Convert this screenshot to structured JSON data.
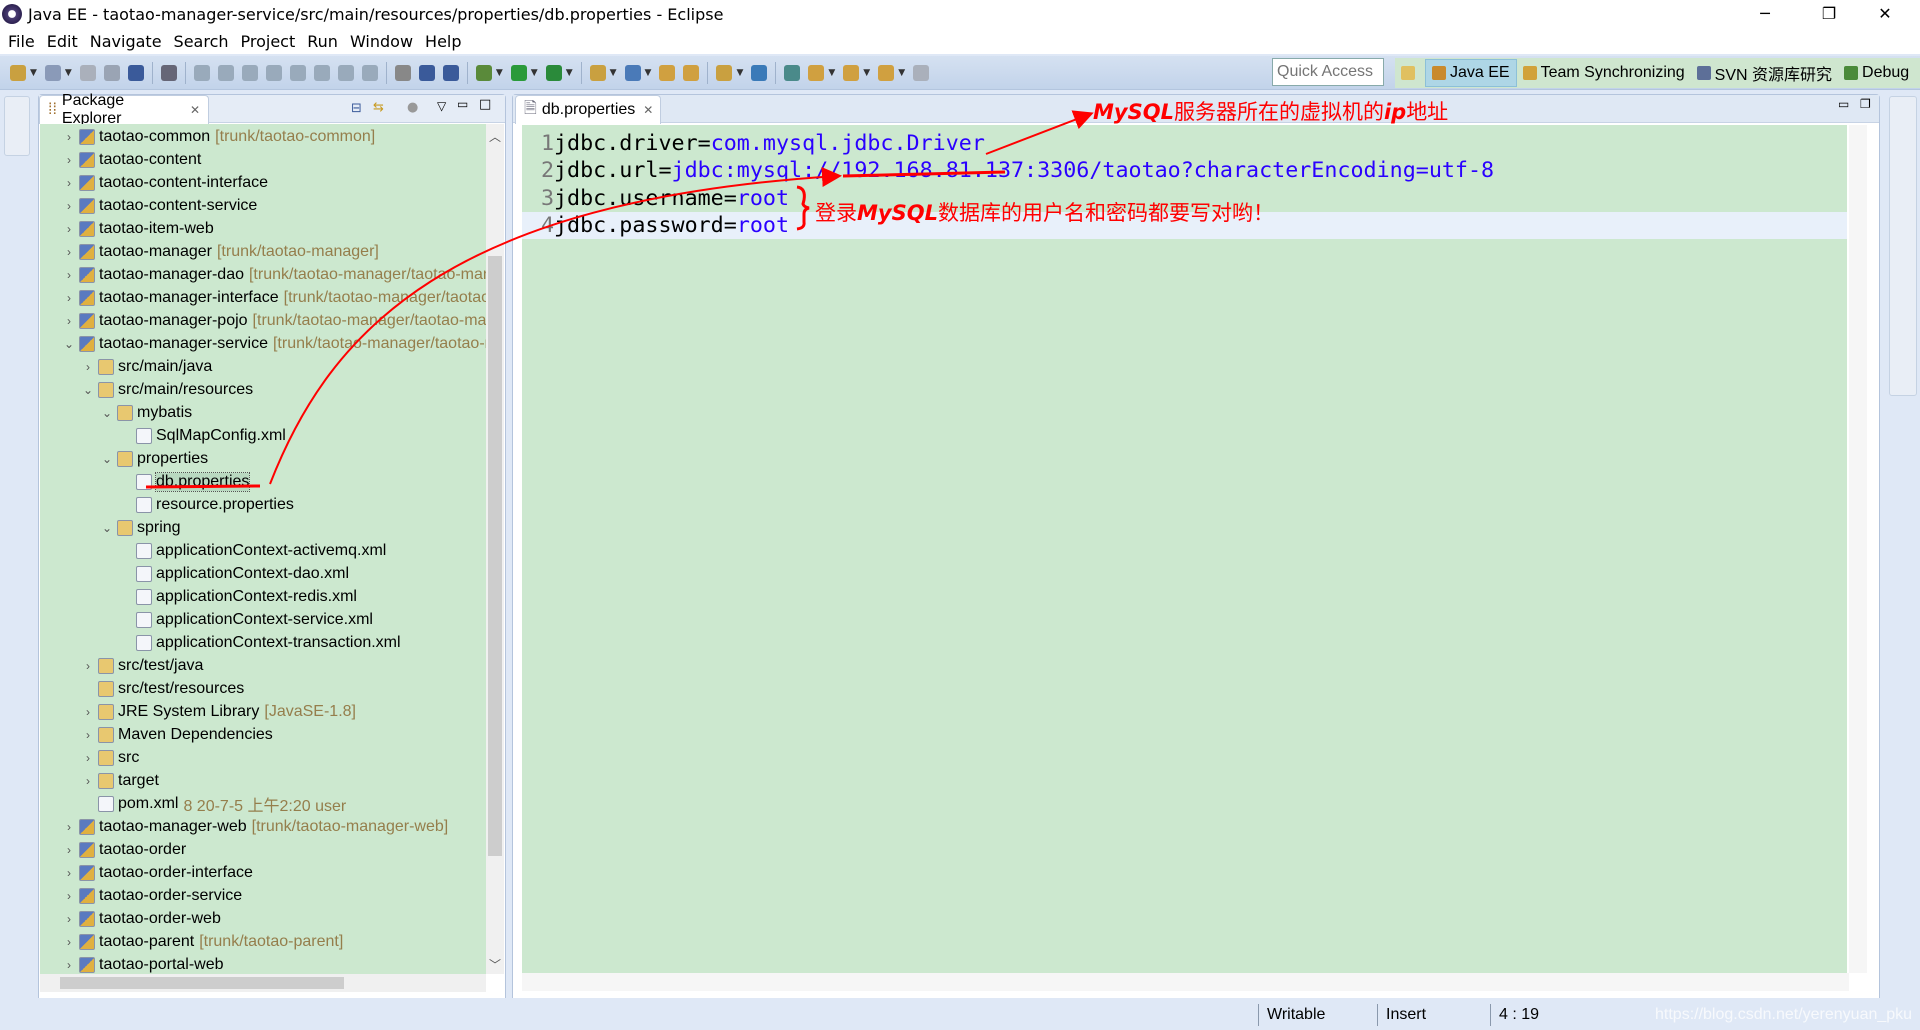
{
  "window": {
    "title": "Java EE - taotao-manager-service/src/main/resources/properties/db.properties - Eclipse",
    "minimize": "─",
    "restore": "❐",
    "close": "✕"
  },
  "menu": [
    "File",
    "Edit",
    "Navigate",
    "Search",
    "Project",
    "Run",
    "Window",
    "Help"
  ],
  "toolbar": {
    "icons": [
      "new-icon",
      "new-dropdown-icon",
      "save-icon",
      "save-all-icon",
      "terminal-icon",
      "skip-breakpoints-icon",
      "resume-icon",
      "suspend-icon",
      "terminate-icon",
      "disconnect-icon",
      "step-into-icon",
      "step-over-icon",
      "step-return-icon",
      "drop-to-frame-icon",
      "use-step-filters-icon",
      "toggle-block-icon",
      "show-whitespace-icon",
      "debug-icon",
      "run-icon",
      "run-server-icon",
      "new-server-icon",
      "new-class-icon",
      "open-type-icon",
      "open-task-icon",
      "search-icon",
      "globe-icon",
      "sync-icon",
      "next-annotation-icon",
      "prev-annotation-icon",
      "back-icon",
      "forward-icon"
    ],
    "quick_access_placeholder": "Quick Access"
  },
  "perspectives": [
    {
      "label": "Java EE",
      "selected": true,
      "color": "#c98a2d"
    },
    {
      "label": "Team Synchronizing",
      "selected": false,
      "color": "#d1a23a"
    },
    {
      "label": "SVN 资源库研究",
      "selected": false,
      "color": "#5d6f98"
    },
    {
      "label": "Debug",
      "selected": false,
      "color": "#4a8a3a"
    }
  ],
  "package_explorer": {
    "tab_label": "Package Explorer",
    "items": [
      {
        "level": 0,
        "arrow": "›",
        "label": "taotao-common",
        "deco": "[trunk/taotao-common]"
      },
      {
        "level": 0,
        "arrow": "›",
        "label": "taotao-content",
        "deco": ""
      },
      {
        "level": 0,
        "arrow": "›",
        "label": "taotao-content-interface",
        "deco": ""
      },
      {
        "level": 0,
        "arrow": "›",
        "label": "taotao-content-service",
        "deco": ""
      },
      {
        "level": 0,
        "arrow": "›",
        "label": "taotao-item-web",
        "deco": ""
      },
      {
        "level": 0,
        "arrow": "›",
        "label": "taotao-manager",
        "deco": "[trunk/taotao-manager]"
      },
      {
        "level": 0,
        "arrow": "›",
        "label": "taotao-manager-dao",
        "deco": "[trunk/taotao-manager/taotao-manager-dao]"
      },
      {
        "level": 0,
        "arrow": "›",
        "label": "taotao-manager-interface",
        "deco": "[trunk/taotao-manager/taotao-manager-interface]"
      },
      {
        "level": 0,
        "arrow": "›",
        "label": "taotao-manager-pojo",
        "deco": "[trunk/taotao-manager/taotao-manager-pojo]"
      },
      {
        "level": 0,
        "arrow": "⌄",
        "label": "taotao-manager-service",
        "deco": "[trunk/taotao-manager/taotao-manager-service]"
      },
      {
        "level": 1,
        "arrow": "›",
        "label": "src/main/java",
        "deco": ""
      },
      {
        "level": 1,
        "arrow": "⌄",
        "label": "src/main/resources",
        "deco": ""
      },
      {
        "level": 2,
        "arrow": "⌄",
        "label": "mybatis",
        "deco": ""
      },
      {
        "level": 3,
        "arrow": "",
        "label": "SqlMapConfig.xml",
        "deco": ""
      },
      {
        "level": 2,
        "arrow": "⌄",
        "label": "properties",
        "deco": ""
      },
      {
        "level": 3,
        "arrow": "",
        "label": "db.properties",
        "deco": "",
        "selected": true
      },
      {
        "level": 3,
        "arrow": "",
        "label": "resource.properties",
        "deco": ""
      },
      {
        "level": 2,
        "arrow": "⌄",
        "label": "spring",
        "deco": ""
      },
      {
        "level": 3,
        "arrow": "",
        "label": "applicationContext-activemq.xml",
        "deco": ""
      },
      {
        "level": 3,
        "arrow": "",
        "label": "applicationContext-dao.xml",
        "deco": ""
      },
      {
        "level": 3,
        "arrow": "",
        "label": "applicationContext-redis.xml",
        "deco": ""
      },
      {
        "level": 3,
        "arrow": "",
        "label": "applicationContext-service.xml",
        "deco": ""
      },
      {
        "level": 3,
        "arrow": "",
        "label": "applicationContext-transaction.xml",
        "deco": ""
      },
      {
        "level": 1,
        "arrow": "›",
        "label": "src/test/java",
        "deco": ""
      },
      {
        "level": 1,
        "arrow": "",
        "label": "src/test/resources",
        "deco": ""
      },
      {
        "level": 1,
        "arrow": "›",
        "label": "JRE System Library",
        "deco": "[JavaSE-1.8]"
      },
      {
        "level": 1,
        "arrow": "›",
        "label": "Maven Dependencies",
        "deco": ""
      },
      {
        "level": 1,
        "arrow": "›",
        "label": "src",
        "deco": ""
      },
      {
        "level": 1,
        "arrow": "›",
        "label": "target",
        "deco": ""
      },
      {
        "level": 1,
        "arrow": "",
        "label": "pom.xml",
        "deco": "8  20-7-5 上午2:20  user"
      },
      {
        "level": 0,
        "arrow": "›",
        "label": "taotao-manager-web",
        "deco": "[trunk/taotao-manager-web]"
      },
      {
        "level": 0,
        "arrow": "›",
        "label": "taotao-order",
        "deco": ""
      },
      {
        "level": 0,
        "arrow": "›",
        "label": "taotao-order-interface",
        "deco": ""
      },
      {
        "level": 0,
        "arrow": "›",
        "label": "taotao-order-service",
        "deco": ""
      },
      {
        "level": 0,
        "arrow": "›",
        "label": "taotao-order-web",
        "deco": ""
      },
      {
        "level": 0,
        "arrow": "›",
        "label": "taotao-parent",
        "deco": "[trunk/taotao-parent]"
      },
      {
        "level": 0,
        "arrow": "›",
        "label": "taotao-portal-web",
        "deco": ""
      }
    ]
  },
  "editor": {
    "tab_label": "db.properties",
    "lines": [
      {
        "n": "1",
        "key": "jdbc.driver=",
        "value": "com.mysql.jdbc.Driver"
      },
      {
        "n": "2",
        "key": "jdbc.url=",
        "value": "jdbc:mysql://192.168.81.137:3306/taotao?characterEncoding=utf-8"
      },
      {
        "n": "3",
        "key": "jdbc.username=",
        "value": "root"
      },
      {
        "n": "4",
        "key": "jdbc.password=",
        "value": "root"
      }
    ]
  },
  "annotations": {
    "ip_note": {
      "em": "MySQL",
      "text": "服务器所在的虚拟机的",
      "em2": "ip",
      "text2": "地址"
    },
    "login_note": {
      "pre": "登录",
      "em": "MySQL",
      "text": "数据库的用户名和密码都要写对哟！"
    },
    "color": "#ff0000"
  },
  "status": {
    "writable": "Writable",
    "insert": "Insert",
    "position": "4 : 19",
    "watermark": "https://blog.csdn.net/yerenyuan_pku"
  }
}
